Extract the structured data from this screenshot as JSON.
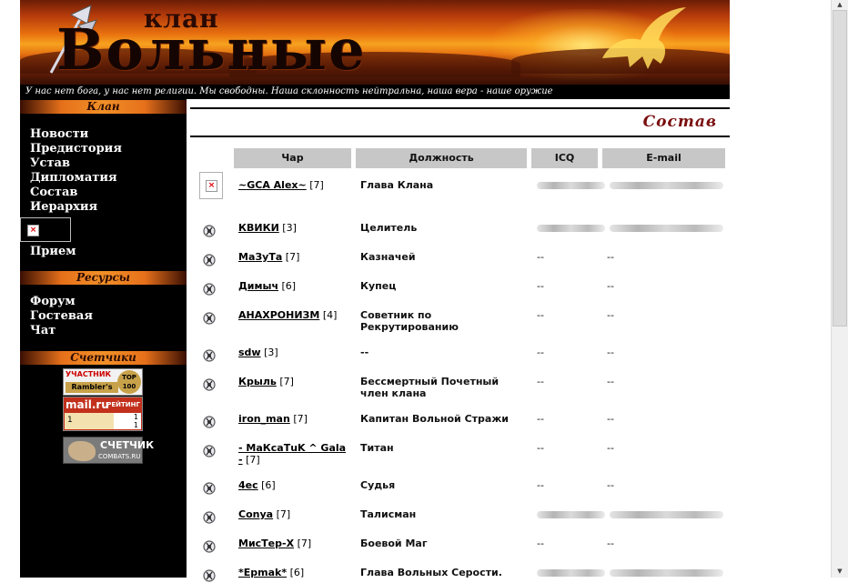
{
  "banner": {
    "clan_word": "клан",
    "title": "Вольные",
    "motto": "У нас нет бога, у нас нет религии. Мы свободны. Наша склонность нейтральна, наша вера - наше оружие"
  },
  "sidebar": {
    "clan_head": "Клан",
    "clan_links": [
      "Новости",
      "Предистория",
      "Устав",
      "Дипломатия",
      "Состав",
      "Иерархия"
    ],
    "clan_links2": [
      "Прием"
    ],
    "resources_head": "Ресурсы",
    "resource_links": [
      "Форум",
      "Гостевая",
      "Чат"
    ],
    "counters_head": "Счетчики",
    "rambler": {
      "line1": "УЧАСТНИК",
      "line2": "Rambler's",
      "badge": "TOP 100"
    },
    "mailru": {
      "logo": "mail.ru",
      "label": "РЕЙТИНГ",
      "value_left": "1",
      "value_right_top": "1",
      "value_right_bot": "1"
    },
    "combats": {
      "title": "СЧЕТЧИК",
      "sub": "COMBATS.RU"
    }
  },
  "section_title": "Состав",
  "table": {
    "headers": [
      "Чар",
      "Должность",
      "ICQ",
      "E-mail"
    ],
    "rows": [
      {
        "name": "~GCA Alex~",
        "level": "[7]",
        "rank": "Глава Клана",
        "icq": "",
        "email": "",
        "blurred": true,
        "broken_icon": true
      },
      {
        "name": "КВИКИ",
        "level": "[3]",
        "rank": "Целитель",
        "icq": "",
        "email": "",
        "blurred": true
      },
      {
        "name": "МаЗуТа",
        "level": "[7]",
        "rank": "Казначей",
        "icq": "--",
        "email": "--"
      },
      {
        "name": "Димыч",
        "level": "[6]",
        "rank": "Купец",
        "icq": "--",
        "email": "--"
      },
      {
        "name": "АНАХРОНИЗМ",
        "level": "[4]",
        "rank": "Советник по Рекрутированию",
        "icq": "--",
        "email": "--"
      },
      {
        "name": "sdw",
        "level": "[3]",
        "rank": "--",
        "icq": "--",
        "email": "--"
      },
      {
        "name": "Крыль",
        "level": "[7]",
        "rank": "Бессмертный Почетный член клана",
        "icq": "--",
        "email": "--"
      },
      {
        "name": "iron_man",
        "level": "[7]",
        "rank": "Капитан Вольной Стражи",
        "icq": "--",
        "email": "--"
      },
      {
        "name": "- МаКсаТuK ^ Gala -",
        "level": "[7]",
        "rank": "Титан",
        "icq": "--",
        "email": "--"
      },
      {
        "name": "4ес",
        "level": "[6]",
        "rank": "Судья",
        "icq": "--",
        "email": "--"
      },
      {
        "name": "Conya",
        "level": "[7]",
        "rank": "Талисман",
        "icq": "",
        "email": "",
        "blurred": true
      },
      {
        "name": "МисТер-Х",
        "level": "[7]",
        "rank": "Боевой Маг",
        "icq": "--",
        "email": "--"
      },
      {
        "name": "*Epmak*",
        "level": "[6]",
        "rank": "Глава Вольных Серости.",
        "icq": "",
        "email": "",
        "blurred": true
      }
    ]
  },
  "colors": {
    "accent": "#e6701a",
    "title_red": "#7a0e0e",
    "header_gray": "#c7c7c7"
  },
  "icons": {
    "row_icon": "clan-emblem-icon",
    "broken": "broken-image-icon"
  }
}
